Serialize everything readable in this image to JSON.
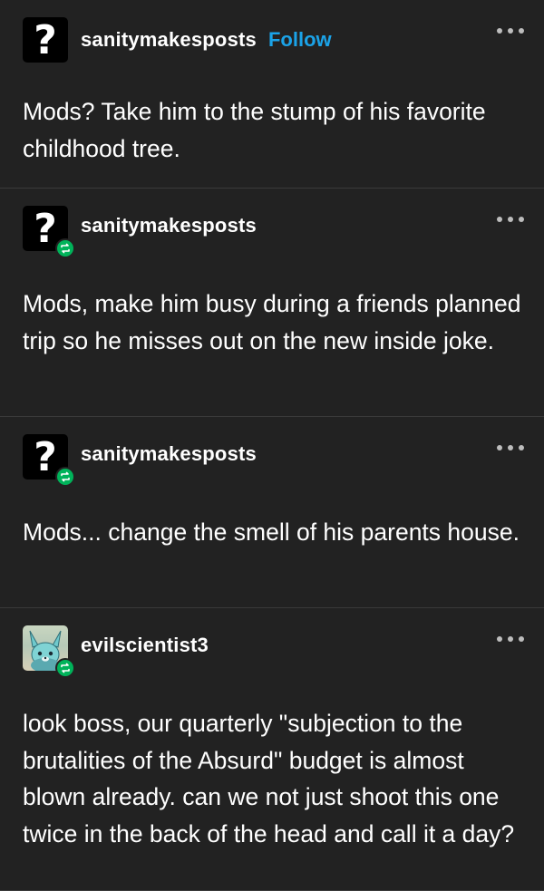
{
  "posts": [
    {
      "username": "sanitymakesposts",
      "follow_label": "Follow",
      "avatar_icon": "question-mark-icon",
      "avatar_glyph": "?",
      "reblog": false,
      "text": "Mods? Take him to the stump of his favorite childhood tree."
    },
    {
      "username": "sanitymakesposts",
      "avatar_icon": "question-mark-icon",
      "avatar_glyph": "?",
      "reblog": true,
      "text": "Mods, make him busy during a friends planned trip so he misses out on the new inside joke."
    },
    {
      "username": "sanitymakesposts",
      "avatar_icon": "question-mark-icon",
      "avatar_glyph": "?",
      "reblog": true,
      "text": "Mods... change the smell of his parents house."
    },
    {
      "username": "evilscientist3",
      "avatar_icon": "fox-avatar-icon",
      "reblog": true,
      "text": "look boss, our quarterly \"subjection to the brutalities of the Absurd\" budget is almost blown already. can we not just shoot this one twice in the back of the head and call it a day?"
    }
  ],
  "colors": {
    "background": "#222222",
    "text": "#ffffff",
    "follow": "#1ba3e8",
    "reblog_badge": "#00b35a",
    "divider": "#3a3a3a"
  },
  "icons": {
    "more": "more-options-icon",
    "reblog": "reblog-icon"
  }
}
